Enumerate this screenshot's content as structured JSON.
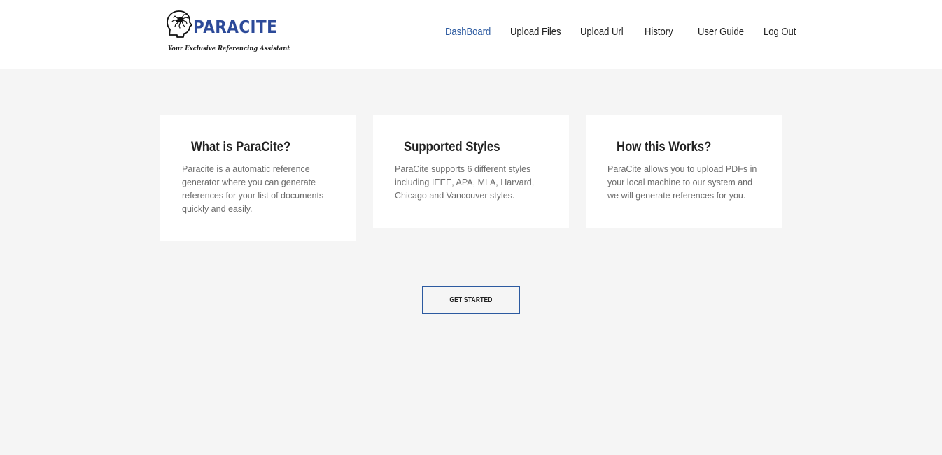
{
  "header": {
    "logo": {
      "wordmark": "PARACITE",
      "tagline": "Your Exclusive Referencing Assistant",
      "icon": "head-with-spider-icon",
      "brand_color": "#2c4a99"
    },
    "nav": [
      {
        "label": "DashBoard",
        "active": true
      },
      {
        "label": "Upload Files",
        "active": false
      },
      {
        "label": "Upload Url",
        "active": false
      },
      {
        "label": "History",
        "active": false
      },
      {
        "label": "User Guide",
        "active": false
      },
      {
        "label": "Log Out",
        "active": false
      }
    ],
    "active_color": "#2c5aa0"
  },
  "cards": [
    {
      "title": "What is ParaCite?",
      "body": "Paracite is a automatic reference generator where you can generate references for your list of documents quickly and easily."
    },
    {
      "title": "Supported Styles",
      "body": "ParaCite supports 6 different styles including IEEE, APA, MLA, Harvard, Chicago and Vancouver styles."
    },
    {
      "title": "How this Works?",
      "body": "ParaCite allows you to upload PDFs in your local machine to our system and we will generate references for you."
    }
  ],
  "cta": {
    "label": "GET STARTED"
  }
}
